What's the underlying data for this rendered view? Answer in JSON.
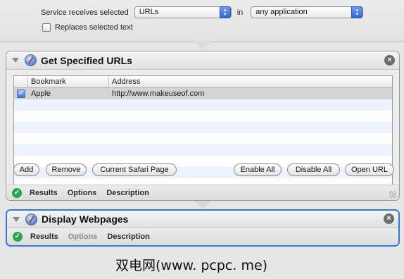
{
  "service": {
    "receives_label": "Service receives selected",
    "input_type": "URLs",
    "in_label": "in",
    "application": "any application",
    "replaces_label": "Replaces selected text"
  },
  "actions": [
    {
      "title": "Get Specified URLs",
      "icon": "safari-icon",
      "table": {
        "headers": [
          "Bookmark",
          "Address"
        ],
        "rows": [
          {
            "checked": true,
            "bookmark": "Apple",
            "address": "http://www.makeuseof.com"
          }
        ]
      },
      "buttons": {
        "add": "Add",
        "remove": "Remove",
        "current_page": "Current Safari Page",
        "enable_all": "Enable All",
        "disable_all": "Disable All",
        "open_url": "Open URL"
      },
      "footer_tabs": [
        "Results",
        "Options",
        "Description"
      ]
    },
    {
      "title": "Display Webpages",
      "icon": "safari-icon",
      "footer_tabs": [
        "Results",
        "Options",
        "Description"
      ]
    }
  ],
  "watermark": "双电网(www. pcpc. me)",
  "colors": {
    "selection": "#2f7cd1",
    "status_ok": "#2aa64a",
    "popup_arrow": "#2f67d6"
  }
}
